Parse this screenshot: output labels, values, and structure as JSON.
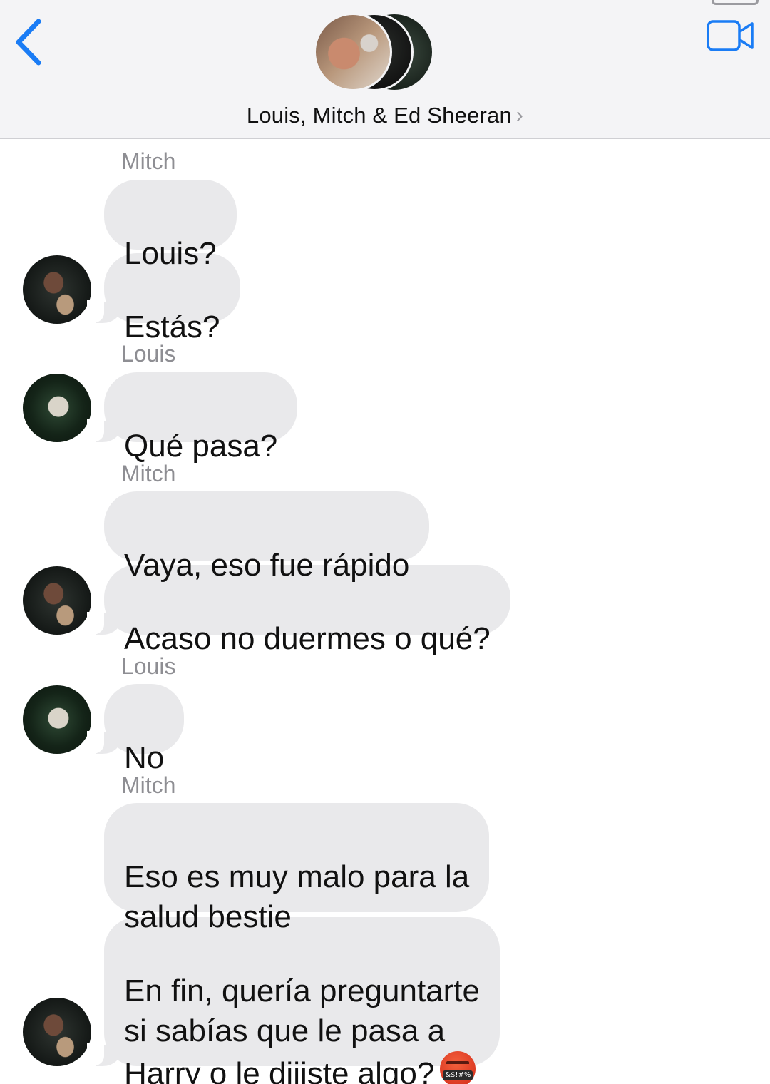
{
  "header": {
    "title": "Louis, Mitch & Ed Sheeran",
    "chevron": "›",
    "back_icon": "chevron-left-icon",
    "video_icon": "video-camera-icon",
    "accent_color": "#1a7cf5"
  },
  "messages": [
    {
      "sender": "Mitch",
      "text": "Louis?"
    },
    {
      "text": "Estás?"
    },
    {
      "sender": "Louis",
      "text": "Qué pasa?"
    },
    {
      "sender": "Mitch",
      "text": "Vaya, eso fue rápido"
    },
    {
      "text": "Acaso no duermes o qué?"
    },
    {
      "sender": "Louis",
      "text": "No"
    },
    {
      "sender": "Mitch",
      "text": "Eso es muy malo para la\nsalud bestie"
    },
    {
      "text": "En fin, quería preguntarte\nsi sabías que le pasa a\nHarry o le dijiste algo?",
      "emoji": "face-with-symbols-on-mouth-emoji"
    }
  ]
}
